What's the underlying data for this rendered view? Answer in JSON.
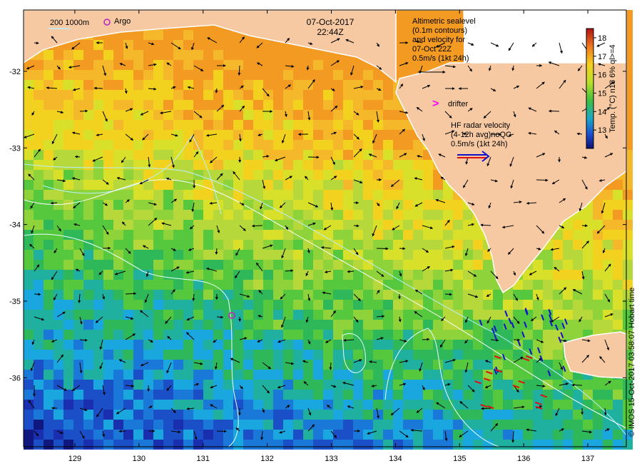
{
  "title": {
    "date": "07-Oct-2017",
    "time": "22:44Z"
  },
  "map": {
    "lon_ticks": [
      "129",
      "130",
      "131",
      "132",
      "133",
      "134",
      "135",
      "136",
      "137"
    ],
    "lat_ticks": [
      "-32",
      "-33",
      "-34",
      "-35",
      "-36"
    ],
    "lon_range": [
      128.2,
      137.6
    ],
    "lat_range": [
      -36.9,
      -31.2
    ]
  },
  "legend": {
    "depth_contours": "200 1000m",
    "argo_label": "Argo",
    "altimetry": [
      "Altimetric sealevel",
      "(0.1m contours)",
      "and velocity for",
      "07-Oct 22Z",
      "0.5m/s (1kt 24h)"
    ],
    "drifter_symbol": ">",
    "drifter_label": "drifter",
    "hf_radar": [
      "HF radar velocity",
      "(4-12h avg)noQC",
      "0.5m/s (1kt 24h)"
    ]
  },
  "colorbar": {
    "ticks": [
      "18",
      "17",
      "16",
      "15",
      "14",
      "13"
    ],
    "label": "Temp. (°C) n18 6% ql>=4",
    "range": [
      12,
      18.5
    ]
  },
  "credit": "© IMOS 15-Oct-2017 03:58:07 Hobart time",
  "colors": {
    "land": "#f7c9a2",
    "sea_warm": "#f39a22",
    "sea_mid": "#8ed33a",
    "sea_cool": "#1aa7e0",
    "sea_cold": "#1a2fb0",
    "contour": "#b9f0ff",
    "hf_radar_blue": "#1010c8",
    "hf_radar_red": "#e01010",
    "argo": "#c020c0",
    "drifter": "#ff00ff"
  }
}
